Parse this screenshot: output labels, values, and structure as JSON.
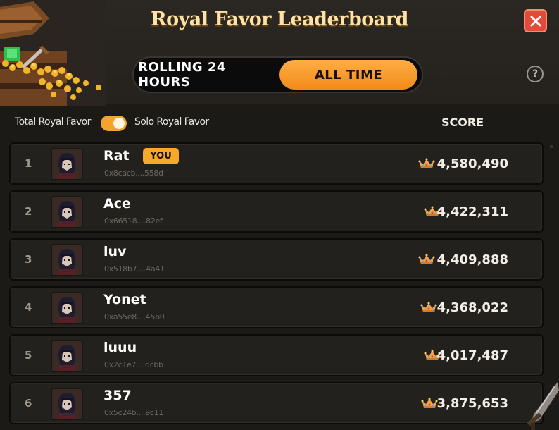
{
  "header": {
    "title": "Royal Favor Leaderboard",
    "close_icon": "close-icon",
    "help_label": "?"
  },
  "time_toggle": {
    "options": [
      "ROLLING 24 HOURS",
      "ALL TIME"
    ],
    "selected": "ALL TIME"
  },
  "filter": {
    "left_label": "Total Royal Favor",
    "right_label": "Solo Royal Favor",
    "toggled_to": "Solo Royal Favor"
  },
  "score_header": "SCORE",
  "you_label": "YOU",
  "rows": [
    {
      "rank": "1",
      "name": "Rat",
      "address": "0x8cacb....558d",
      "score": "4,580,490",
      "is_you": true
    },
    {
      "rank": "2",
      "name": "Ace",
      "address": "0x66518....82ef",
      "score": "4,422,311",
      "is_you": false
    },
    {
      "rank": "3",
      "name": "luv",
      "address": "0x518b7....4a41",
      "score": "4,409,888",
      "is_you": false
    },
    {
      "rank": "4",
      "name": "Yonet",
      "address": "0xa55e8....45b0",
      "score": "4,368,022",
      "is_you": false
    },
    {
      "rank": "5",
      "name": "luuu",
      "address": "0x2c1e7....dcbb",
      "score": "4,017,487",
      "is_you": false
    },
    {
      "rank": "6",
      "name": "357",
      "address": "0x5c24b....9c11",
      "score": "3,875,653",
      "is_you": false
    }
  ],
  "colors": {
    "accent_orange": "#f28a18",
    "close_red": "#e24a3b",
    "title_cream": "#ffe3a6"
  }
}
